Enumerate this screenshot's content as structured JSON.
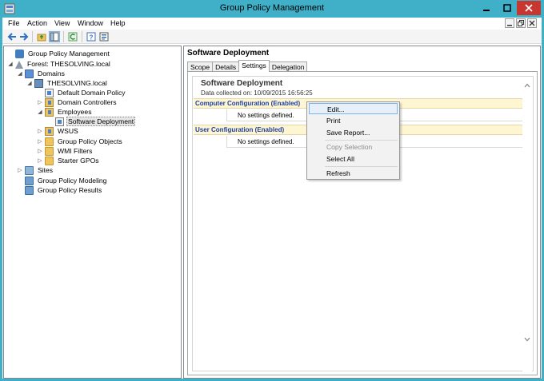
{
  "window": {
    "title": "Group Policy Management",
    "accent_color": "#3fb0c7",
    "close_color": "#c7372f"
  },
  "menu": {
    "items": [
      "File",
      "Action",
      "View",
      "Window",
      "Help"
    ]
  },
  "toolbar": {
    "icons": [
      "back-icon",
      "forward-icon",
      "up-folder-icon",
      "show-hide-tree-icon",
      "refresh-icon",
      "help-icon",
      "properties-icon"
    ]
  },
  "tree": {
    "root": "Group Policy Management",
    "forest": "Forest: THESOLVING.local",
    "domains": "Domains",
    "domain": "THESOLVING.local",
    "default_policy": "Default Domain Policy",
    "domain_controllers": "Domain Controllers",
    "employees": "Employees",
    "software_deployment": "Software Deployment",
    "wsus": "WSUS",
    "gpo_container": "Group Policy Objects",
    "wmi_filters": "WMI Filters",
    "starter_gpos": "Starter GPOs",
    "sites": "Sites",
    "modeling": "Group Policy Modeling",
    "results": "Group Policy Results"
  },
  "details": {
    "header": "Software Deployment",
    "tabs": [
      "Scope",
      "Details",
      "Settings",
      "Delegation"
    ],
    "active_tab": "Settings",
    "report": {
      "title": "Software Deployment",
      "collected": "Data collected on: 10/09/2015 16:56:25",
      "computer_section": "Computer Configuration (Enabled)",
      "computer_value": "No settings defined.",
      "user_section": "User Configuration (Enabled)",
      "user_value": "No settings defined."
    }
  },
  "context_menu": {
    "edit": "Edit...",
    "print": "Print",
    "save_report": "Save Report...",
    "copy_selection": "Copy Selection",
    "select_all": "Select All",
    "refresh": "Refresh"
  }
}
